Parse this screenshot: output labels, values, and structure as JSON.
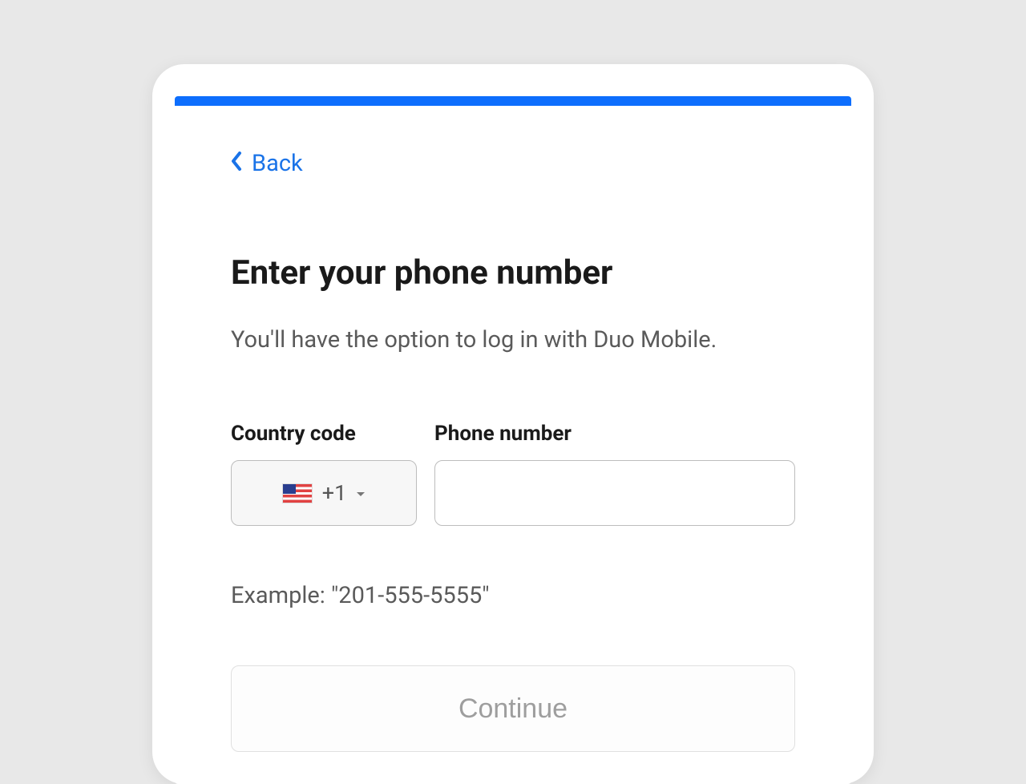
{
  "nav": {
    "back_label": "Back"
  },
  "header": {
    "title": "Enter your phone number",
    "subtitle": "You'll have the option to log in with Duo Mobile."
  },
  "form": {
    "country_label": "Country code",
    "phone_label": "Phone number",
    "dial_code": "+1",
    "phone_value": "",
    "example_text": "Example: \"201-555-5555\""
  },
  "actions": {
    "continue_label": "Continue"
  },
  "colors": {
    "accent": "#0d6efd",
    "link": "#1a73e8"
  }
}
